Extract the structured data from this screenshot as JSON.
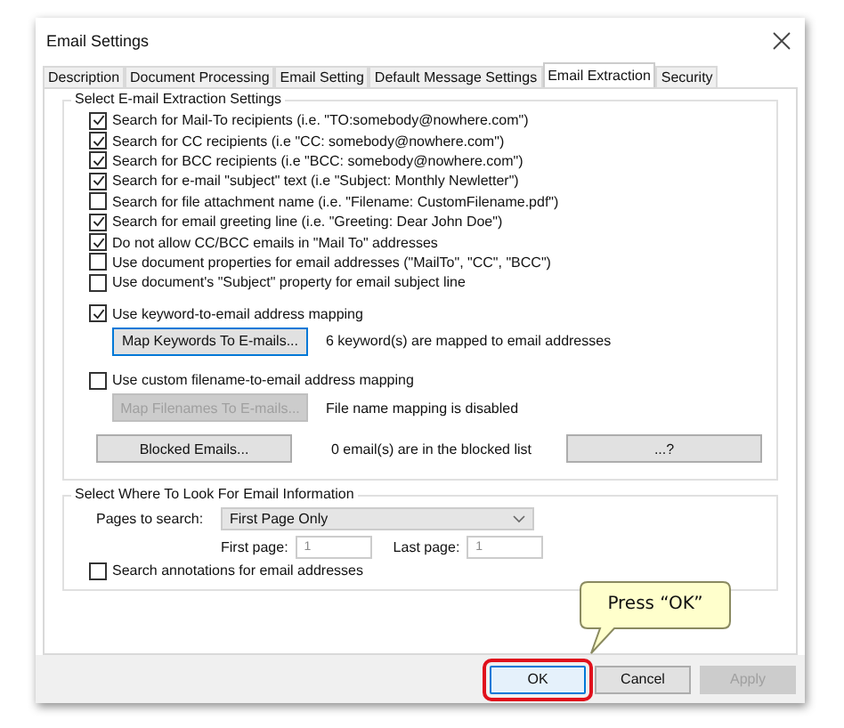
{
  "window": {
    "title": "Email Settings"
  },
  "tabs": [
    {
      "label": "Description",
      "selected": false
    },
    {
      "label": "Document Processing",
      "selected": false
    },
    {
      "label": "Email Setting",
      "selected": false
    },
    {
      "label": "Default Message Settings",
      "selected": false
    },
    {
      "label": "Email Extraction",
      "selected": true
    },
    {
      "label": "Security",
      "selected": false
    }
  ],
  "extraction_group": {
    "title": "Select E-mail Extraction Settings",
    "options": [
      {
        "label": "Search for Mail-To recipients (i.e. \"TO:somebody@nowhere.com\")",
        "checked": true
      },
      {
        "label": "Search for CC recipients (i.e \"CC: somebody@nowhere.com\")",
        "checked": true
      },
      {
        "label": "Search for BCC recipients (i.e \"BCC: somebody@nowhere.com\")",
        "checked": true
      },
      {
        "label": "Search for e-mail \"subject\" text (i.e \"Subject: Monthly Newletter\")",
        "checked": true
      },
      {
        "label": "Search for file attachment name (i.e. \"Filename: CustomFilename.pdf\")",
        "checked": false
      },
      {
        "label": "Search for email greeting line (i.e. \"Greeting: Dear John Doe\")",
        "checked": true
      },
      {
        "label": "Do not allow CC/BCC emails in \"Mail To\" addresses",
        "checked": true
      },
      {
        "label": "Use document properties for email addresses (\"MailTo\", \"CC\", \"BCC\")",
        "checked": false
      },
      {
        "label": "Use document's \"Subject\" property for email subject line",
        "checked": false
      }
    ],
    "mappings": [
      {
        "label": "Use keyword-to-email address mapping",
        "checked": true,
        "button": "Map Keywords To E-mails...",
        "disabled": false,
        "status": "6 keyword(s) are mapped to email addresses"
      },
      {
        "label": "Use custom filename-to-email address mapping",
        "checked": false,
        "button": "Map Filenames To E-mails...",
        "disabled": true,
        "status": "File name mapping is disabled"
      }
    ],
    "blocked": {
      "button": "Blocked Emails...",
      "status": "0 email(s) are in the blocked list",
      "help_button": "...?"
    }
  },
  "location_group": {
    "title": "Select Where To Look For Email Information",
    "pages_label": "Pages to search:",
    "pages_value": "First Page Only",
    "first_page_label": "First page:",
    "first_page_value": "1",
    "last_page_label": "Last page:",
    "last_page_value": "1",
    "annotations": {
      "label": "Search annotations for email addresses",
      "checked": false
    }
  },
  "callout": {
    "text": "Press “OK”"
  },
  "buttons": [
    {
      "label": "OK",
      "highlighted": true,
      "disabled": false
    },
    {
      "label": "Cancel",
      "highlighted": false,
      "disabled": false
    },
    {
      "label": "Apply",
      "highlighted": false,
      "disabled": true
    }
  ]
}
